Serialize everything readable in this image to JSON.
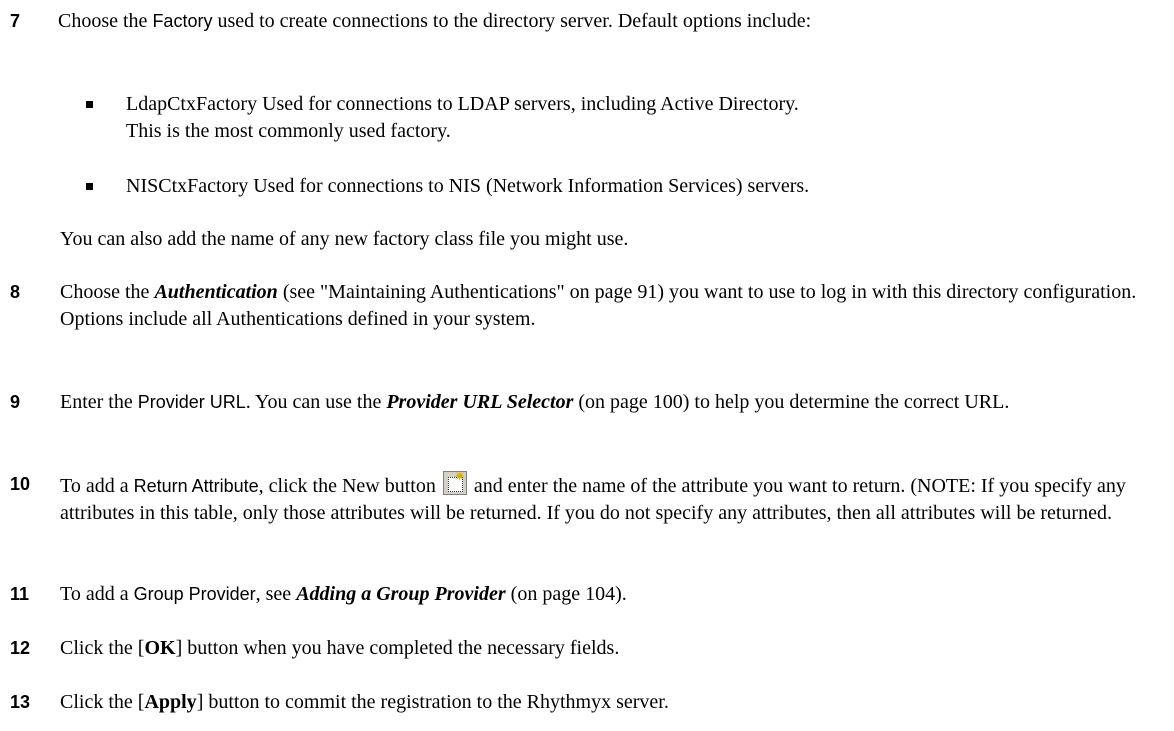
{
  "steps": {
    "s7": {
      "num": "7",
      "pre": "Choose the ",
      "ui": "Factory",
      "post": " used to create connections to the directory server.  Default options include:"
    },
    "bullets": [
      {
        "line1": "LdapCtxFactory  Used for connections to LDAP servers, including Active Directory.",
        "line2": "This is the most commonly used factory."
      },
      {
        "line1": "NISCtxFactory  Used for connections to NIS (Network Information Services) servers."
      }
    ],
    "s7_note": "You can also add the name of any new factory class file you might use.",
    "s8": {
      "num": "8",
      "pre": "Choose the ",
      "link": "Authentication",
      "post": " (see \"Maintaining Authentications\" on page 91) you want to use to log in with this directory configuration.  Options include all Authentications defined in your system."
    },
    "s9": {
      "num": "9",
      "pre": "Enter the ",
      "ui": "Provider URL",
      "mid": ".  You can use the ",
      "link": "Provider URL Selector",
      "post": " (on page 100) to help you determine the correct URL."
    },
    "s10": {
      "num": "10",
      "pre": "To add a ",
      "ui": "Return Attribute",
      "mid": ", click the New button",
      "post": " and enter the name of the attribute you want to return. (NOTE:  If you specify any attributes in this table, only those attributes will be returned.  If you do not specify any attributes, then all attributes will be returned."
    },
    "s11": {
      "num": "11",
      "pre": "To add a ",
      "ui": "Group Provider",
      "mid": ", see ",
      "link": "Adding a Group Provider",
      "post": " (on page 104)."
    },
    "s12": {
      "num": "12",
      "pre": "Click the [",
      "btn": "OK",
      "post": "] button when you have completed the necessary fields."
    },
    "s13": {
      "num": "13",
      "pre": "Click the [",
      "btn": "Apply",
      "post": "] button to commit the registration to the Rhythmyx server."
    }
  },
  "icons": {
    "new_button": "new-item-icon"
  }
}
